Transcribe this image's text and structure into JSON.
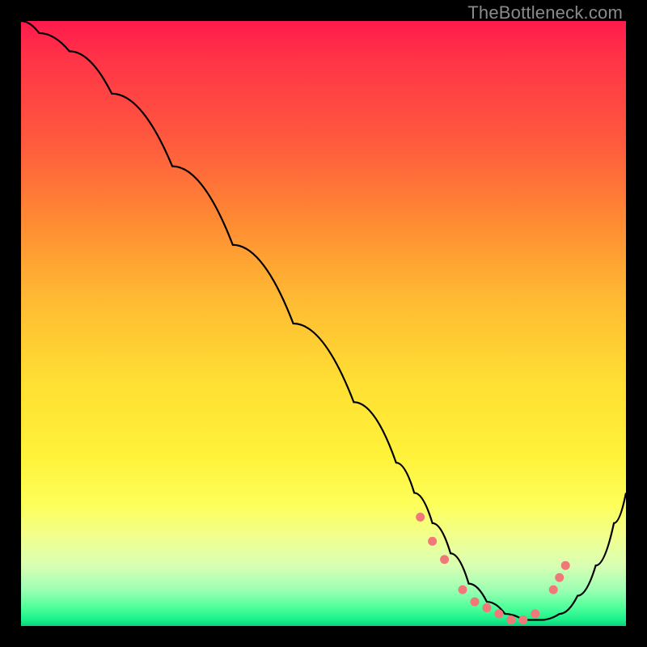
{
  "watermark": "TheBottleneck.com",
  "colors": {
    "black": "#000000",
    "dot": "#f07878",
    "line": "#000000"
  },
  "chart_data": {
    "type": "line",
    "title": "",
    "xlabel": "",
    "ylabel": "",
    "xlim": [
      0,
      100
    ],
    "ylim": [
      0,
      100
    ],
    "grid": false,
    "series": [
      {
        "name": "bottleneck_curve",
        "x": [
          0,
          3,
          8,
          15,
          25,
          35,
          45,
          55,
          62,
          65,
          68,
          71,
          74,
          77,
          80,
          83,
          86,
          89,
          92,
          95,
          98,
          100
        ],
        "y": [
          100,
          98,
          95,
          88,
          76,
          63,
          50,
          37,
          27,
          22,
          17,
          12,
          7,
          4,
          2,
          1,
          1,
          2,
          5,
          10,
          17,
          22
        ]
      }
    ],
    "markers": {
      "name": "optimal_zone",
      "x": [
        66,
        68,
        70,
        73,
        75,
        77,
        79,
        81,
        83,
        85,
        88,
        89,
        90
      ],
      "y": [
        18,
        14,
        11,
        6,
        4,
        3,
        2,
        1,
        1,
        2,
        6,
        8,
        10
      ]
    }
  }
}
